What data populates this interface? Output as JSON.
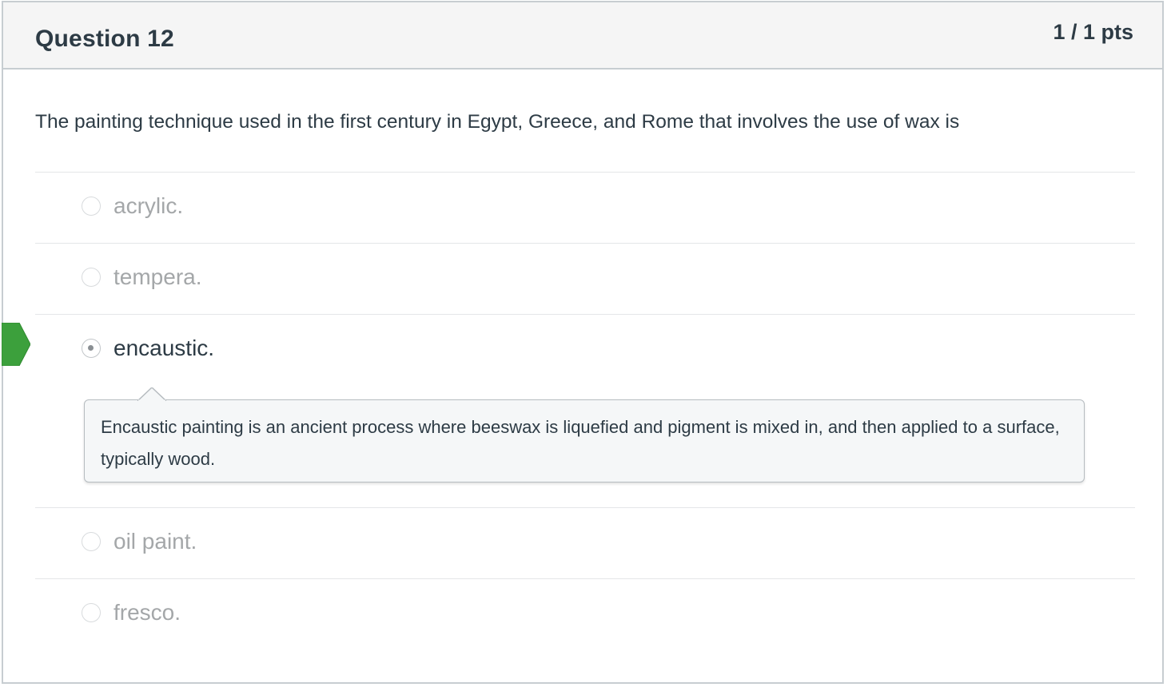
{
  "question": {
    "title": "Question 12",
    "points": "1 / 1 pts",
    "text": "The painting technique used in the first century in Egypt, Greece, and Rome that involves the use of wax is"
  },
  "answers": [
    {
      "label": "acrylic.",
      "selected": false
    },
    {
      "label": "tempera.",
      "selected": false
    },
    {
      "label": "encaustic.",
      "selected": true,
      "correct": true,
      "comment": "Encaustic painting is an ancient process where beeswax is liquefied and pigment is mixed in, and then applied to a surface, typically wood."
    },
    {
      "label": "oil paint.",
      "selected": false
    },
    {
      "label": "fresco.",
      "selected": false
    }
  ],
  "colors": {
    "correct_marker": "#3ca03c",
    "header_bg": "#f5f5f5",
    "text": "#2d3b45",
    "muted_text": "#a4a7a9"
  },
  "icons": {
    "correct_marker": "correct-answer-arrow-icon",
    "radio": "radio-button-icon"
  }
}
